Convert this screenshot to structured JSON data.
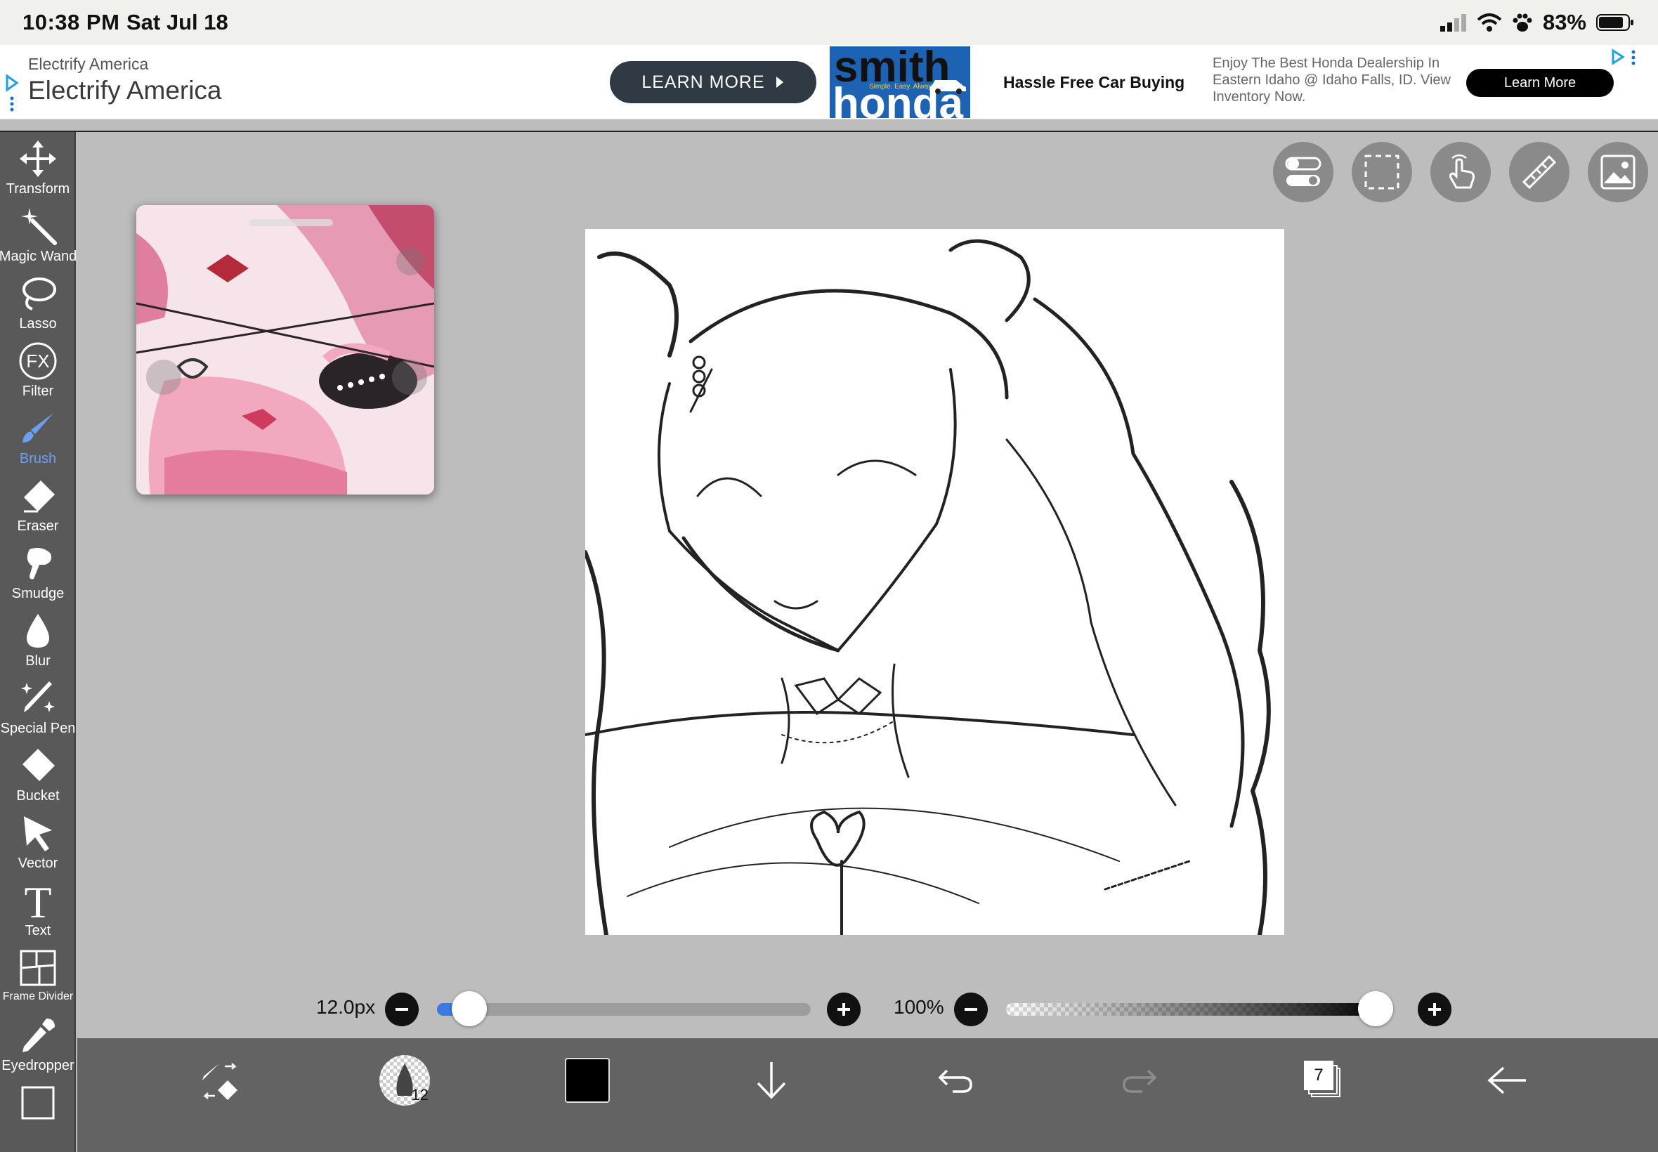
{
  "status_bar": {
    "time": "10:38 PM",
    "date": "Sat Jul 18",
    "battery": "83%"
  },
  "ad": {
    "advertiser_small": "Electrify America",
    "advertiser_big": "Electrify America",
    "cta_1": "LEARN MORE",
    "logo_line1": "smith",
    "logo_line2": "honda",
    "logo_tagline": "Simple. Easy. Always.",
    "headline": "Hassle Free Car Buying",
    "body": "Enjoy The Best Honda Dealership In Eastern Idaho @ Idaho Falls, ID. View Inventory Now.",
    "cta_2": "Learn More"
  },
  "tools": [
    {
      "id": "transform",
      "label": "Transform",
      "icon": "move-arrows-icon"
    },
    {
      "id": "magic-wand",
      "label": "Magic Wand",
      "icon": "magic-wand-icon"
    },
    {
      "id": "lasso",
      "label": "Lasso",
      "icon": "lasso-icon"
    },
    {
      "id": "filter",
      "label": "Filter",
      "icon": "fx-icon"
    },
    {
      "id": "brush",
      "label": "Brush",
      "icon": "brush-icon",
      "active": true
    },
    {
      "id": "eraser",
      "label": "Eraser",
      "icon": "eraser-icon"
    },
    {
      "id": "smudge",
      "label": "Smudge",
      "icon": "smudge-icon"
    },
    {
      "id": "blur",
      "label": "Blur",
      "icon": "drop-icon"
    },
    {
      "id": "special-pen",
      "label": "Special Pen",
      "icon": "sparkle-pen-icon"
    },
    {
      "id": "bucket",
      "label": "Bucket",
      "icon": "bucket-icon"
    },
    {
      "id": "vector",
      "label": "Vector",
      "icon": "cursor-arrow-icon"
    },
    {
      "id": "text",
      "label": "Text",
      "icon": "text-t-icon"
    },
    {
      "id": "frame-divider",
      "label": "Frame Divider",
      "icon": "frame-divider-icon"
    },
    {
      "id": "eyedropper",
      "label": "Eyedropper",
      "icon": "eyedropper-icon"
    }
  ],
  "brush_size": {
    "label": "12.0px",
    "fraction": 0.06
  },
  "opacity": {
    "label": "100%",
    "fraction": 1.0
  },
  "bottom_bar": {
    "brush_preview_number": "12",
    "current_color": "#000000",
    "layer_count": "7"
  },
  "colors": {
    "accent": "#3d7ae0",
    "toolbar": "#595959",
    "bottom_bar": "#636363",
    "canvas_bg": "#bdbdbd"
  }
}
